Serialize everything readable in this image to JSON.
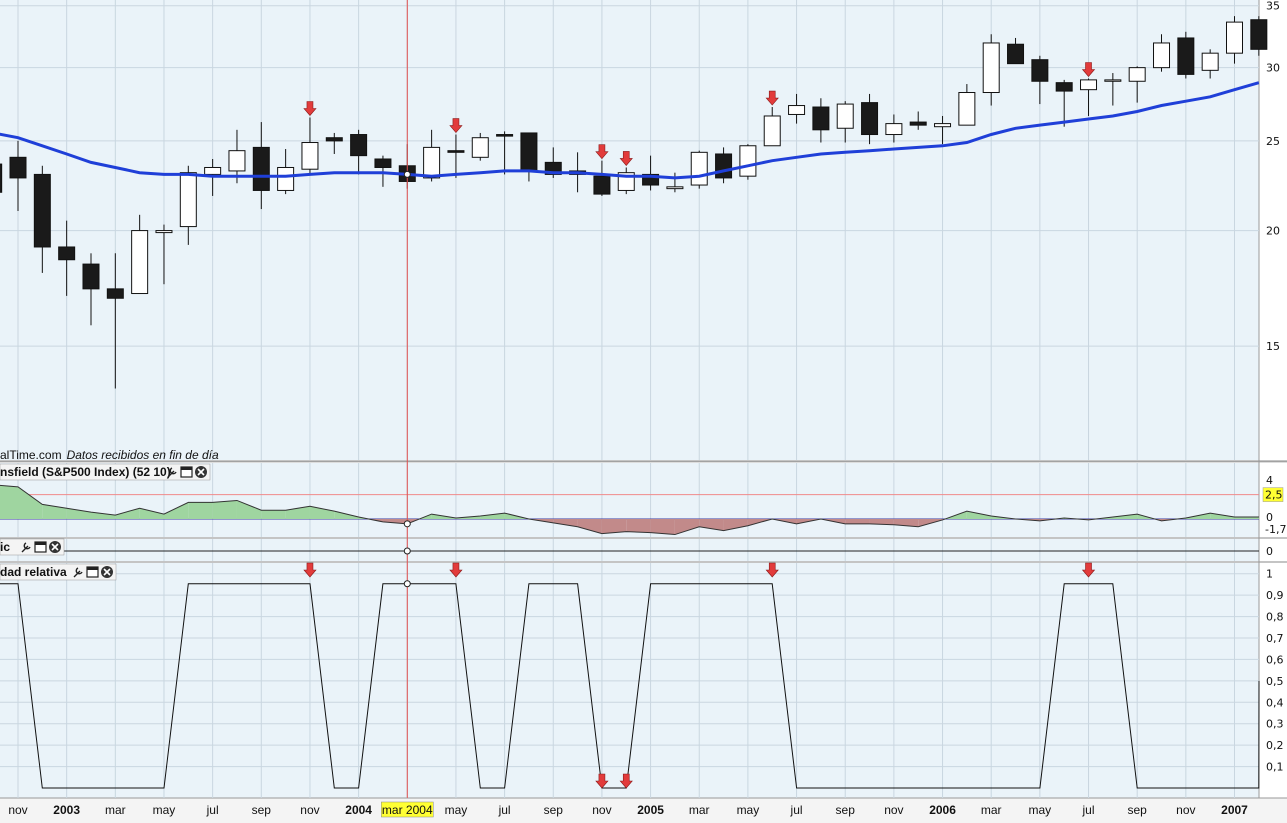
{
  "source_label": {
    "site": "alTime.com",
    "note": "Datos recibidos en fin de día"
  },
  "panels": {
    "mansfield_title": "nsfield (S&P500 Index) (52 10)",
    "pane2_title": "ic",
    "relative_title": "dad relativa"
  },
  "cursor_label": "mar 2004",
  "colors": {
    "background": "#eaf3f9",
    "ma_line": "#1f3fd8",
    "bull_body": "#ffffff",
    "bear_body": "#1a1a1a",
    "signal_arrow": "#e23b3b",
    "mansfield_pos": "#9fd5a0",
    "mansfield_neg": "#c28a8a",
    "cursor": "#e05050",
    "highlight_label": "#ffff33"
  },
  "chart_data": [
    {
      "type": "candlestick",
      "name": "price",
      "x": [
        "2002-10",
        "2002-11",
        "2002-12",
        "2003-01",
        "2003-02",
        "2003-03",
        "2003-04",
        "2003-05",
        "2003-06",
        "2003-07",
        "2003-08",
        "2003-09",
        "2003-10",
        "2003-11",
        "2003-12",
        "2004-01",
        "2004-02",
        "2004-03",
        "2004-04",
        "2004-05",
        "2004-06",
        "2004-07",
        "2004-08",
        "2004-09",
        "2004-10",
        "2004-11",
        "2004-12",
        "2005-01",
        "2005-02",
        "2005-03",
        "2005-04",
        "2005-05",
        "2005-06",
        "2005-07",
        "2005-08",
        "2005-09",
        "2005-10",
        "2005-11",
        "2005-12",
        "2006-01",
        "2006-02",
        "2006-03",
        "2006-04",
        "2006-05",
        "2006-06",
        "2006-07",
        "2006-08",
        "2006-09",
        "2006-10",
        "2006-11",
        "2006-12",
        "2007-01",
        "2007-02"
      ],
      "ohlc": [
        [
          23.6,
          24.8,
          21.2,
          22.0
        ],
        [
          24.0,
          25.0,
          21.0,
          22.8
        ],
        [
          23.0,
          23.5,
          18.0,
          19.2
        ],
        [
          19.2,
          20.5,
          17.0,
          18.6
        ],
        [
          18.4,
          18.9,
          15.8,
          17.3
        ],
        [
          17.3,
          18.9,
          13.5,
          16.9
        ],
        [
          17.1,
          20.8,
          17.1,
          20.0
        ],
        [
          19.9,
          20.3,
          17.5,
          20.0
        ],
        [
          20.2,
          23.5,
          19.3,
          23.1
        ],
        [
          23.0,
          23.9,
          21.8,
          23.4
        ],
        [
          23.2,
          25.7,
          22.5,
          24.4
        ],
        [
          24.6,
          26.2,
          21.1,
          22.1
        ],
        [
          22.1,
          24.5,
          21.9,
          23.4
        ],
        [
          23.3,
          26.5,
          23.0,
          24.9
        ],
        [
          25.2,
          25.5,
          24.2,
          25.0
        ],
        [
          25.4,
          25.7,
          23.0,
          24.1
        ],
        [
          23.9,
          24.1,
          22.3,
          23.4
        ],
        [
          23.5,
          24.8,
          22.2,
          22.6
        ],
        [
          22.8,
          25.7,
          22.6,
          24.6
        ],
        [
          24.4,
          25.4,
          22.8,
          24.3
        ],
        [
          24.0,
          25.5,
          23.8,
          25.2
        ],
        [
          25.4,
          25.6,
          23.0,
          25.3
        ],
        [
          25.5,
          25.5,
          22.6,
          23.2
        ],
        [
          23.7,
          24.6,
          22.8,
          23.0
        ],
        [
          23.2,
          24.3,
          22.0,
          23.0
        ],
        [
          22.9,
          23.8,
          21.8,
          21.9
        ],
        [
          22.1,
          23.4,
          21.9,
          23.1
        ],
        [
          23.0,
          24.1,
          22.1,
          22.4
        ],
        [
          22.2,
          23.1,
          22.0,
          22.3
        ],
        [
          22.4,
          24.4,
          22.2,
          24.3
        ],
        [
          24.2,
          24.6,
          22.5,
          22.8
        ],
        [
          22.9,
          24.8,
          22.7,
          24.7
        ],
        [
          24.7,
          27.2,
          24.7,
          26.6
        ],
        [
          26.7,
          28.1,
          26.1,
          27.3
        ],
        [
          27.2,
          27.8,
          24.9,
          25.7
        ],
        [
          25.8,
          27.6,
          24.9,
          27.4
        ],
        [
          27.5,
          28.1,
          24.8,
          25.4
        ],
        [
          25.4,
          26.7,
          24.9,
          26.1
        ],
        [
          26.2,
          26.9,
          25.7,
          26.0
        ],
        [
          25.9,
          26.6,
          24.8,
          26.1
        ],
        [
          26.0,
          28.8,
          26.0,
          28.2
        ],
        [
          28.2,
          32.6,
          27.3,
          31.9
        ],
        [
          31.8,
          32.3,
          30.3,
          30.3
        ],
        [
          30.6,
          30.9,
          27.4,
          29.0
        ],
        [
          28.9,
          29.1,
          25.9,
          28.3
        ],
        [
          28.4,
          29.2,
          26.6,
          29.1
        ],
        [
          29.0,
          29.6,
          27.3,
          29.1
        ],
        [
          29.0,
          30.1,
          27.5,
          30.0
        ],
        [
          30.0,
          32.6,
          29.7,
          31.9
        ],
        [
          32.3,
          32.8,
          29.2,
          29.5
        ],
        [
          29.8,
          31.4,
          29.2,
          31.1
        ],
        [
          31.1,
          34.1,
          30.3,
          33.6
        ],
        [
          33.8,
          34.1,
          30.9,
          31.4
        ]
      ],
      "moving_average": [
        25.5,
        25.2,
        24.7,
        24.2,
        23.7,
        23.4,
        23.1,
        23.0,
        23.0,
        22.9,
        22.9,
        22.9,
        22.9,
        23.0,
        23.1,
        23.1,
        23.1,
        23.0,
        22.9,
        23.0,
        23.1,
        23.2,
        23.2,
        23.1,
        23.1,
        23.0,
        22.9,
        22.9,
        22.8,
        22.9,
        23.2,
        23.5,
        23.8,
        24.0,
        24.2,
        24.3,
        24.4,
        24.5,
        24.6,
        24.7,
        24.9,
        25.4,
        25.8,
        26.0,
        26.2,
        26.4,
        26.6,
        26.9,
        27.3,
        27.6,
        27.9,
        28.4,
        28.9
      ],
      "signal_arrows_at": [
        "2003-11",
        "2004-05",
        "2004-11",
        "2004-12",
        "2005-06",
        "2006-07"
      ],
      "y_ticks": [
        15,
        20,
        25,
        30,
        35
      ],
      "ylim": [
        11.3,
        35.5
      ],
      "y_scale": "log"
    },
    {
      "type": "area",
      "name": "Mansfield (S&P500 Index) (52 10)",
      "x": [
        "2002-10",
        "2002-11",
        "2002-12",
        "2003-01",
        "2003-02",
        "2003-03",
        "2003-04",
        "2003-05",
        "2003-06",
        "2003-07",
        "2003-08",
        "2003-09",
        "2003-10",
        "2003-11",
        "2003-12",
        "2004-01",
        "2004-02",
        "2004-03",
        "2004-04",
        "2004-05",
        "2004-06",
        "2004-07",
        "2004-08",
        "2004-09",
        "2004-10",
        "2004-11",
        "2004-12",
        "2005-01",
        "2005-02",
        "2005-03",
        "2005-04",
        "2005-05",
        "2005-06",
        "2005-07",
        "2005-08",
        "2005-09",
        "2005-10",
        "2005-11",
        "2005-12",
        "2006-01",
        "2006-02",
        "2006-03",
        "2006-04",
        "2006-05",
        "2006-06",
        "2006-07",
        "2006-08",
        "2006-09",
        "2006-10",
        "2006-11",
        "2006-12",
        "2007-01",
        "2007-02"
      ],
      "values": [
        3.5,
        3.3,
        1.5,
        1.1,
        0.7,
        0.4,
        1.1,
        0.5,
        1.7,
        1.7,
        1.9,
        0.9,
        0.9,
        1.3,
        0.8,
        0.2,
        -0.3,
        -0.5,
        0.5,
        0.1,
        0.3,
        0.6,
        0.0,
        -0.4,
        -0.8,
        -1.5,
        -1.3,
        -1.4,
        -1.6,
        -0.8,
        -1.2,
        -0.7,
        0.0,
        -0.5,
        0.0,
        -0.5,
        -0.5,
        -0.6,
        -0.8,
        -0.1,
        0.8,
        0.3,
        0.0,
        -0.2,
        0.1,
        -0.1,
        0.2,
        0.5,
        -0.2,
        0.1,
        0.6,
        0.2,
        0.2
      ],
      "y_ticks": [
        "4",
        "2,5",
        "0",
        "-1,7"
      ],
      "reference_level": "2,5",
      "ylim": [
        -1.75,
        4
      ]
    },
    {
      "type": "line",
      "name": "ic",
      "y_ticks": [
        "0"
      ],
      "values_constant": 0
    },
    {
      "type": "line",
      "name": "dad relativa",
      "x": [
        "2002-10",
        "2002-11",
        "2002-12",
        "2003-01",
        "2003-02",
        "2003-03",
        "2003-04",
        "2003-05",
        "2003-06",
        "2003-07",
        "2003-08",
        "2003-09",
        "2003-10",
        "2003-11",
        "2003-12",
        "2004-01",
        "2004-02",
        "2004-03",
        "2004-04",
        "2004-05",
        "2004-06",
        "2004-07",
        "2004-08",
        "2004-09",
        "2004-10",
        "2004-11",
        "2004-12",
        "2005-01",
        "2005-02",
        "2005-03",
        "2005-04",
        "2005-05",
        "2005-06",
        "2005-07",
        "2005-08",
        "2005-09",
        "2005-10",
        "2005-11",
        "2005-12",
        "2006-01",
        "2006-02",
        "2006-03",
        "2006-04",
        "2006-05",
        "2006-06",
        "2006-07",
        "2006-08",
        "2006-09",
        "2006-10",
        "2006-11",
        "2006-12",
        "2007-01",
        "2007-02"
      ],
      "values": [
        1,
        1,
        0,
        0,
        0,
        0,
        0,
        0,
        1,
        1,
        1,
        1,
        1,
        1,
        0,
        0,
        1,
        1,
        1,
        1,
        0,
        0,
        1,
        1,
        1,
        0,
        0,
        1,
        1,
        1,
        1,
        1,
        1,
        0,
        0,
        0,
        0,
        0,
        0,
        0,
        0,
        0,
        0,
        0,
        1,
        1,
        1,
        0,
        0,
        0,
        0,
        0,
        0
      ],
      "tail_value": 0.5,
      "y_ticks": [
        "0,1",
        "0,2",
        "0,3",
        "0,4",
        "0,5",
        "0,6",
        "0,7",
        "0,8",
        "0,9",
        "1"
      ],
      "ylim": [
        0,
        1.05
      ]
    }
  ],
  "x_axis": {
    "labels": [
      "nov",
      "2003",
      "mar",
      "may",
      "jul",
      "sep",
      "nov",
      "2004",
      "mar 2004",
      "may",
      "jul",
      "sep",
      "nov",
      "2005",
      "mar",
      "may",
      "jul",
      "sep",
      "nov",
      "2006",
      "mar",
      "may",
      "jul",
      "sep",
      "nov",
      "2007"
    ],
    "label_months": [
      "2002-11",
      "2003-01",
      "2003-03",
      "2003-05",
      "2003-07",
      "2003-09",
      "2003-11",
      "2004-01",
      "2004-03",
      "2004-05",
      "2004-07",
      "2004-09",
      "2004-11",
      "2005-01",
      "2005-03",
      "2005-05",
      "2005-07",
      "2005-09",
      "2005-11",
      "2006-01",
      "2006-03",
      "2006-05",
      "2006-07",
      "2006-09",
      "2006-11",
      "2007-01"
    ],
    "year_labels": [
      "2003",
      "2004",
      "2005",
      "2006",
      "2007"
    ],
    "cursor_month": "2004-03"
  }
}
